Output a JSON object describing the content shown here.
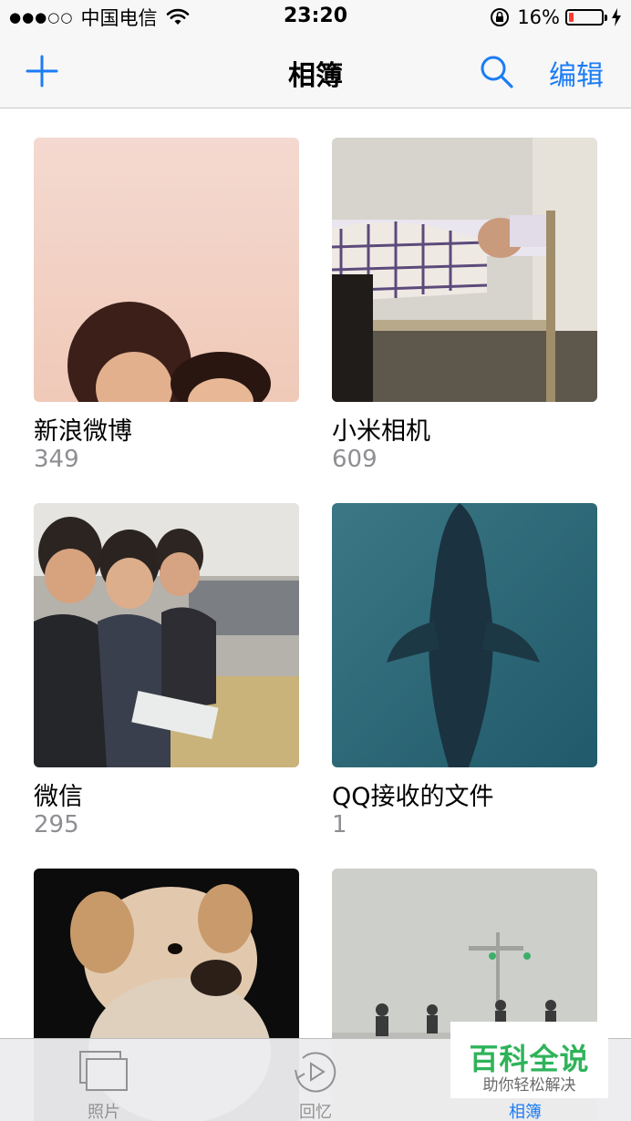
{
  "status_bar": {
    "signal": "●●●○○",
    "carrier": "中国电信",
    "time": "23:20",
    "battery_percent": "16%",
    "battery_level": 0.16,
    "battery_color": "#ff3b30"
  },
  "nav": {
    "title": "相簿",
    "edit_label": "编辑",
    "accent": "#1b7cf5"
  },
  "albums": [
    {
      "name": "新浪微博",
      "count": "349"
    },
    {
      "name": "小米相机",
      "count": "609"
    },
    {
      "name": "微信",
      "count": "295"
    },
    {
      "name": "QQ接收的文件",
      "count": "1"
    },
    {
      "name": "",
      "count": ""
    },
    {
      "name": "",
      "count": ""
    }
  ],
  "tabs": [
    {
      "label": "照片",
      "icon": "photos-icon"
    },
    {
      "label": "回忆",
      "icon": "memories-icon"
    },
    {
      "label": "相簿",
      "icon": "albums-icon",
      "active": true
    }
  ],
  "watermark": {
    "title": "百科全说",
    "subtitle": "助你轻松解决"
  }
}
